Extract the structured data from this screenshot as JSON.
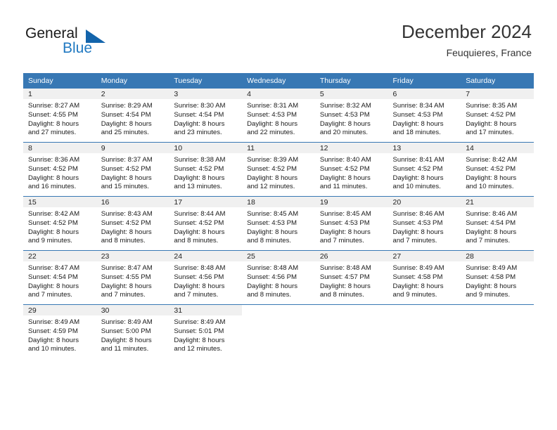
{
  "brand": {
    "name_part1": "General",
    "name_part2": "Blue",
    "triangle_color": "#1364ab",
    "blue_color": "#1f78c1"
  },
  "header": {
    "title": "December 2024",
    "subtitle": "Feuquieres, France"
  },
  "theme": {
    "header_row_bg": "#3878b4",
    "daynum_bg": "#f0f0f0",
    "grid_line": "#3878b4"
  },
  "weekday_headers": [
    "Sunday",
    "Monday",
    "Tuesday",
    "Wednesday",
    "Thursday",
    "Friday",
    "Saturday"
  ],
  "weeks": [
    [
      {
        "day": "1",
        "sunrise": "Sunrise: 8:27 AM",
        "sunset": "Sunset: 4:55 PM",
        "daylight1": "Daylight: 8 hours",
        "daylight2": "and 27 minutes."
      },
      {
        "day": "2",
        "sunrise": "Sunrise: 8:29 AM",
        "sunset": "Sunset: 4:54 PM",
        "daylight1": "Daylight: 8 hours",
        "daylight2": "and 25 minutes."
      },
      {
        "day": "3",
        "sunrise": "Sunrise: 8:30 AM",
        "sunset": "Sunset: 4:54 PM",
        "daylight1": "Daylight: 8 hours",
        "daylight2": "and 23 minutes."
      },
      {
        "day": "4",
        "sunrise": "Sunrise: 8:31 AM",
        "sunset": "Sunset: 4:53 PM",
        "daylight1": "Daylight: 8 hours",
        "daylight2": "and 22 minutes."
      },
      {
        "day": "5",
        "sunrise": "Sunrise: 8:32 AM",
        "sunset": "Sunset: 4:53 PM",
        "daylight1": "Daylight: 8 hours",
        "daylight2": "and 20 minutes."
      },
      {
        "day": "6",
        "sunrise": "Sunrise: 8:34 AM",
        "sunset": "Sunset: 4:53 PM",
        "daylight1": "Daylight: 8 hours",
        "daylight2": "and 18 minutes."
      },
      {
        "day": "7",
        "sunrise": "Sunrise: 8:35 AM",
        "sunset": "Sunset: 4:52 PM",
        "daylight1": "Daylight: 8 hours",
        "daylight2": "and 17 minutes."
      }
    ],
    [
      {
        "day": "8",
        "sunrise": "Sunrise: 8:36 AM",
        "sunset": "Sunset: 4:52 PM",
        "daylight1": "Daylight: 8 hours",
        "daylight2": "and 16 minutes."
      },
      {
        "day": "9",
        "sunrise": "Sunrise: 8:37 AM",
        "sunset": "Sunset: 4:52 PM",
        "daylight1": "Daylight: 8 hours",
        "daylight2": "and 15 minutes."
      },
      {
        "day": "10",
        "sunrise": "Sunrise: 8:38 AM",
        "sunset": "Sunset: 4:52 PM",
        "daylight1": "Daylight: 8 hours",
        "daylight2": "and 13 minutes."
      },
      {
        "day": "11",
        "sunrise": "Sunrise: 8:39 AM",
        "sunset": "Sunset: 4:52 PM",
        "daylight1": "Daylight: 8 hours",
        "daylight2": "and 12 minutes."
      },
      {
        "day": "12",
        "sunrise": "Sunrise: 8:40 AM",
        "sunset": "Sunset: 4:52 PM",
        "daylight1": "Daylight: 8 hours",
        "daylight2": "and 11 minutes."
      },
      {
        "day": "13",
        "sunrise": "Sunrise: 8:41 AM",
        "sunset": "Sunset: 4:52 PM",
        "daylight1": "Daylight: 8 hours",
        "daylight2": "and 10 minutes."
      },
      {
        "day": "14",
        "sunrise": "Sunrise: 8:42 AM",
        "sunset": "Sunset: 4:52 PM",
        "daylight1": "Daylight: 8 hours",
        "daylight2": "and 10 minutes."
      }
    ],
    [
      {
        "day": "15",
        "sunrise": "Sunrise: 8:42 AM",
        "sunset": "Sunset: 4:52 PM",
        "daylight1": "Daylight: 8 hours",
        "daylight2": "and 9 minutes."
      },
      {
        "day": "16",
        "sunrise": "Sunrise: 8:43 AM",
        "sunset": "Sunset: 4:52 PM",
        "daylight1": "Daylight: 8 hours",
        "daylight2": "and 8 minutes."
      },
      {
        "day": "17",
        "sunrise": "Sunrise: 8:44 AM",
        "sunset": "Sunset: 4:52 PM",
        "daylight1": "Daylight: 8 hours",
        "daylight2": "and 8 minutes."
      },
      {
        "day": "18",
        "sunrise": "Sunrise: 8:45 AM",
        "sunset": "Sunset: 4:53 PM",
        "daylight1": "Daylight: 8 hours",
        "daylight2": "and 8 minutes."
      },
      {
        "day": "19",
        "sunrise": "Sunrise: 8:45 AM",
        "sunset": "Sunset: 4:53 PM",
        "daylight1": "Daylight: 8 hours",
        "daylight2": "and 7 minutes."
      },
      {
        "day": "20",
        "sunrise": "Sunrise: 8:46 AM",
        "sunset": "Sunset: 4:53 PM",
        "daylight1": "Daylight: 8 hours",
        "daylight2": "and 7 minutes."
      },
      {
        "day": "21",
        "sunrise": "Sunrise: 8:46 AM",
        "sunset": "Sunset: 4:54 PM",
        "daylight1": "Daylight: 8 hours",
        "daylight2": "and 7 minutes."
      }
    ],
    [
      {
        "day": "22",
        "sunrise": "Sunrise: 8:47 AM",
        "sunset": "Sunset: 4:54 PM",
        "daylight1": "Daylight: 8 hours",
        "daylight2": "and 7 minutes."
      },
      {
        "day": "23",
        "sunrise": "Sunrise: 8:47 AM",
        "sunset": "Sunset: 4:55 PM",
        "daylight1": "Daylight: 8 hours",
        "daylight2": "and 7 minutes."
      },
      {
        "day": "24",
        "sunrise": "Sunrise: 8:48 AM",
        "sunset": "Sunset: 4:56 PM",
        "daylight1": "Daylight: 8 hours",
        "daylight2": "and 7 minutes."
      },
      {
        "day": "25",
        "sunrise": "Sunrise: 8:48 AM",
        "sunset": "Sunset: 4:56 PM",
        "daylight1": "Daylight: 8 hours",
        "daylight2": "and 8 minutes."
      },
      {
        "day": "26",
        "sunrise": "Sunrise: 8:48 AM",
        "sunset": "Sunset: 4:57 PM",
        "daylight1": "Daylight: 8 hours",
        "daylight2": "and 8 minutes."
      },
      {
        "day": "27",
        "sunrise": "Sunrise: 8:49 AM",
        "sunset": "Sunset: 4:58 PM",
        "daylight1": "Daylight: 8 hours",
        "daylight2": "and 9 minutes."
      },
      {
        "day": "28",
        "sunrise": "Sunrise: 8:49 AM",
        "sunset": "Sunset: 4:58 PM",
        "daylight1": "Daylight: 8 hours",
        "daylight2": "and 9 minutes."
      }
    ],
    [
      {
        "day": "29",
        "sunrise": "Sunrise: 8:49 AM",
        "sunset": "Sunset: 4:59 PM",
        "daylight1": "Daylight: 8 hours",
        "daylight2": "and 10 minutes."
      },
      {
        "day": "30",
        "sunrise": "Sunrise: 8:49 AM",
        "sunset": "Sunset: 5:00 PM",
        "daylight1": "Daylight: 8 hours",
        "daylight2": "and 11 minutes."
      },
      {
        "day": "31",
        "sunrise": "Sunrise: 8:49 AM",
        "sunset": "Sunset: 5:01 PM",
        "daylight1": "Daylight: 8 hours",
        "daylight2": "and 12 minutes."
      },
      {
        "day": "",
        "sunrise": "",
        "sunset": "",
        "daylight1": "",
        "daylight2": ""
      },
      {
        "day": "",
        "sunrise": "",
        "sunset": "",
        "daylight1": "",
        "daylight2": ""
      },
      {
        "day": "",
        "sunrise": "",
        "sunset": "",
        "daylight1": "",
        "daylight2": ""
      },
      {
        "day": "",
        "sunrise": "",
        "sunset": "",
        "daylight1": "",
        "daylight2": ""
      }
    ]
  ]
}
